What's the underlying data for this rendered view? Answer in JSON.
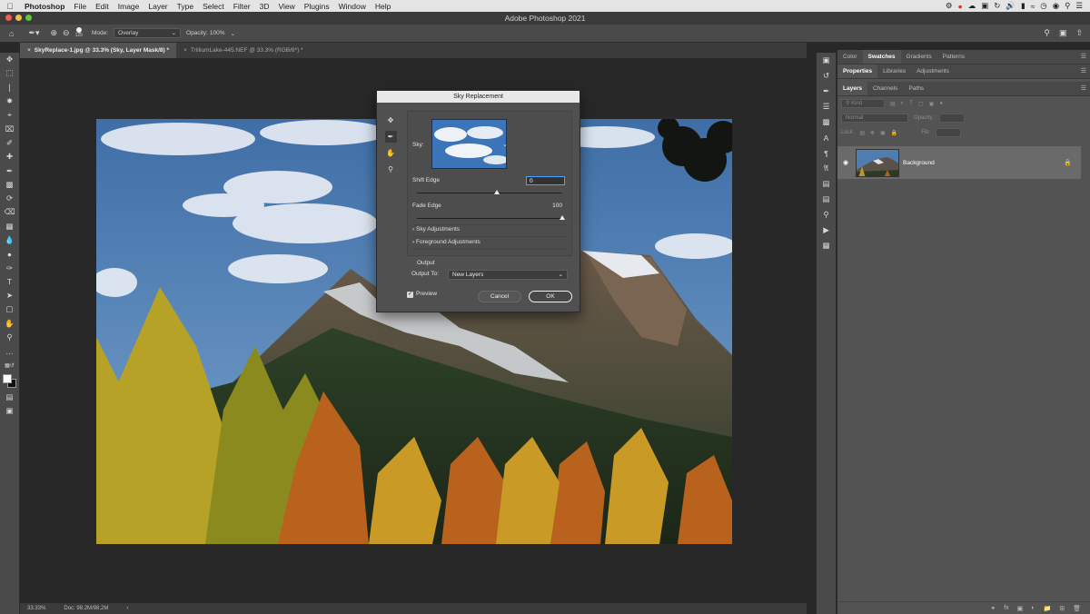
{
  "menubar": {
    "app": "Photoshop",
    "items": [
      "File",
      "Edit",
      "Image",
      "Layer",
      "Type",
      "Select",
      "Filter",
      "3D",
      "View",
      "Plugins",
      "Window",
      "Help"
    ]
  },
  "window_title": "Adobe Photoshop 2021",
  "options": {
    "brush_size": "125",
    "mode_label": "Mode:",
    "mode_value": "Overlay",
    "opacity_label": "Opacity:",
    "opacity_value": "100%"
  },
  "doc_tabs": [
    {
      "label": "SkyReplace-1.jpg @ 33.3% (Sky, Layer Mask/8) *",
      "active": true
    },
    {
      "label": "TrilliumLake-445.NEF @ 33.3% (RGB/8*) *",
      "active": false
    }
  ],
  "status": {
    "zoom": "33.33%",
    "doc": "Doc: 98.2M/98.2M"
  },
  "panel_tabs_top": [
    "Color",
    "Swatches",
    "Gradients",
    "Patterns"
  ],
  "panel_tabs_mid": [
    "Properties",
    "Libraries",
    "Adjustments"
  ],
  "panel_tabs_layers": [
    "Layers",
    "Channels",
    "Paths"
  ],
  "layers_filter": {
    "kind": "Kind",
    "blend": "Normal",
    "opacity_label": "Opacity:",
    "lock_label": "Lock:",
    "fill_label": "Fill:"
  },
  "layers": [
    {
      "name": "Background",
      "visible": true,
      "locked": true
    }
  ],
  "dialog": {
    "title": "Sky Replacement",
    "sky_label": "Sky:",
    "shift_edge_label": "Shift Edge",
    "shift_edge_value": "0",
    "fade_edge_label": "Fade Edge",
    "fade_edge_value": "100",
    "sky_adjustments": "Sky Adjustments",
    "foreground_adjustments": "Foreground Adjustments",
    "output_header": "Output",
    "output_to_label": "Output To:",
    "output_to_value": "New Layers",
    "preview_label": "Preview",
    "preview_checked": true,
    "cancel": "Cancel",
    "ok": "OK",
    "shift_edge_level": 0.55,
    "fade_edge_level": 1.0
  },
  "colors": {
    "accent": "#4aa3ff",
    "panel": "#535353",
    "canvas_bg": "#282828"
  }
}
